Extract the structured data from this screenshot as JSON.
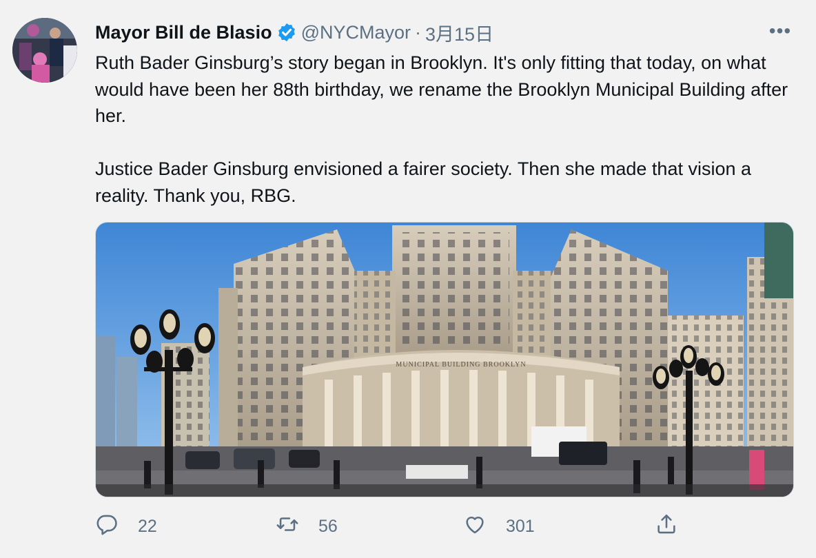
{
  "tweet": {
    "author_name": "Mayor Bill de Blasio",
    "handle": "@NYCMayor",
    "separator": "·",
    "date": "3月15日",
    "more_label": "•••",
    "paragraphs": [
      "Ruth Bader Ginsburg’s story began in Brooklyn. It's only fitting that today, on what would have been her 88th birthday, we rename the Brooklyn Municipal Building after her.",
      "Justice Bader Ginsburg envisioned a fairer society. Then she made that vision a reality. Thank you, RBG."
    ],
    "media": {
      "facade_inscription": "MUNICIPAL BUILDING BROOKLYN"
    },
    "stats": {
      "replies": "22",
      "retweets": "56",
      "likes": "301"
    }
  },
  "icons": {
    "verified": "verified-badge-icon",
    "reply": "speech-bubble-icon",
    "retweet": "retweet-arrows-icon",
    "like": "heart-icon",
    "share": "share-upload-icon"
  },
  "colors": {
    "verified": "#1d9bf0",
    "secondary_text": "#5b7083",
    "background": "#f2f2f2"
  }
}
